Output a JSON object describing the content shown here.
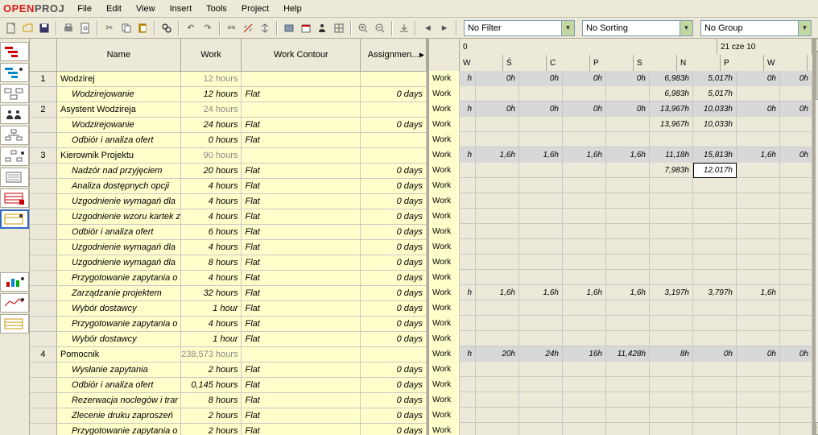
{
  "app": {
    "logo_open": "OPEN",
    "logo_proj": "PROJ"
  },
  "menu": [
    "File",
    "Edit",
    "View",
    "Insert",
    "Tools",
    "Project",
    "Help"
  ],
  "filters": {
    "filter": "No Filter",
    "sort": "No Sorting",
    "group": "No Group"
  },
  "columns": {
    "name": "Name",
    "work": "Work",
    "contour": "Work Contour",
    "assign": "Assignmen..."
  },
  "timeline": {
    "top_left": "0",
    "top_right": "21 cze 10",
    "days": [
      "W",
      "Ś",
      "C",
      "P",
      "S",
      "N",
      "P",
      "W"
    ]
  },
  "work_label": "Work",
  "rows": [
    {
      "n": "1",
      "name": "Wodzirej",
      "work": "12 hours",
      "contour": "",
      "assign": "",
      "parent": true,
      "r": [
        "h",
        "0h",
        "0h",
        "0h",
        "0h",
        "6,983h",
        "5,017h",
        "0h",
        "0h"
      ],
      "dim": true
    },
    {
      "n": "",
      "name": "Wodzirejowanie",
      "work": "12 hours",
      "contour": "Flat",
      "assign": "0 days",
      "parent": false,
      "r": [
        "",
        "",
        "",
        "",
        "",
        "6,983h",
        "5,017h",
        "",
        ""
      ],
      "dim": false
    },
    {
      "n": "2",
      "name": "Asystent Wodzireja",
      "work": "24 hours",
      "contour": "",
      "assign": "",
      "parent": true,
      "r": [
        "h",
        "0h",
        "0h",
        "0h",
        "0h",
        "13,967h",
        "10,033h",
        "0h",
        "0h"
      ],
      "dim": true
    },
    {
      "n": "",
      "name": "Wodzirejowanie",
      "work": "24 hours",
      "contour": "Flat",
      "assign": "0 days",
      "parent": false,
      "r": [
        "",
        "",
        "",
        "",
        "",
        "13,967h",
        "10,033h",
        "",
        ""
      ],
      "dim": false
    },
    {
      "n": "",
      "name": "Odbiór i analiza ofert",
      "work": "0 hours",
      "contour": "Flat",
      "assign": "",
      "parent": false,
      "r": [
        "",
        "",
        "",
        "",
        "",
        "",
        "",
        "",
        ""
      ],
      "dim": false
    },
    {
      "n": "3",
      "name": "Kierownik Projektu",
      "work": "90 hours",
      "contour": "",
      "assign": "",
      "parent": true,
      "r": [
        "h",
        "1,6h",
        "1,6h",
        "1,6h",
        "1,6h",
        "11,18h",
        "15,813h",
        "1,6h",
        "0h"
      ],
      "dim": true
    },
    {
      "n": "",
      "name": "Nadzór nad przyjęciem",
      "work": "20 hours",
      "contour": "Flat",
      "assign": "0 days",
      "parent": false,
      "r": [
        "",
        "",
        "",
        "",
        "",
        "7,983h",
        "12,017h",
        "",
        ""
      ],
      "dim": false,
      "sel": 6
    },
    {
      "n": "",
      "name": "Analiza dostępnych opcji",
      "work": "4 hours",
      "contour": "Flat",
      "assign": "0 days",
      "parent": false,
      "r": [
        "",
        "",
        "",
        "",
        "",
        "",
        "",
        "",
        ""
      ],
      "dim": false
    },
    {
      "n": "",
      "name": "Uzgodnienie wymagań dla",
      "work": "4 hours",
      "contour": "Flat",
      "assign": "0 days",
      "parent": false,
      "r": [
        "",
        "",
        "",
        "",
        "",
        "",
        "",
        "",
        ""
      ],
      "dim": false
    },
    {
      "n": "",
      "name": "Uzgodnienie wzoru kartek z",
      "work": "4 hours",
      "contour": "Flat",
      "assign": "0 days",
      "parent": false,
      "r": [
        "",
        "",
        "",
        "",
        "",
        "",
        "",
        "",
        ""
      ],
      "dim": false
    },
    {
      "n": "",
      "name": "Odbiór i analiza ofert",
      "work": "6 hours",
      "contour": "Flat",
      "assign": "0 days",
      "parent": false,
      "r": [
        "",
        "",
        "",
        "",
        "",
        "",
        "",
        "",
        ""
      ],
      "dim": false
    },
    {
      "n": "",
      "name": "Uzgodnienie wymagań dla",
      "work": "4 hours",
      "contour": "Flat",
      "assign": "0 days",
      "parent": false,
      "r": [
        "",
        "",
        "",
        "",
        "",
        "",
        "",
        "",
        ""
      ],
      "dim": false
    },
    {
      "n": "",
      "name": "Uzgodnienie wymagań dla",
      "work": "8 hours",
      "contour": "Flat",
      "assign": "0 days",
      "parent": false,
      "r": [
        "",
        "",
        "",
        "",
        "",
        "",
        "",
        "",
        ""
      ],
      "dim": false
    },
    {
      "n": "",
      "name": "Przygotowanie zapytania o",
      "work": "4 hours",
      "contour": "Flat",
      "assign": "0 days",
      "parent": false,
      "r": [
        "",
        "",
        "",
        "",
        "",
        "",
        "",
        "",
        ""
      ],
      "dim": false
    },
    {
      "n": "",
      "name": "Zarządzanie projektem",
      "work": "32 hours",
      "contour": "Flat",
      "assign": "0 days",
      "parent": false,
      "r": [
        "h",
        "1,6h",
        "1,6h",
        "1,6h",
        "1,6h",
        "3,197h",
        "3,797h",
        "1,6h",
        ""
      ],
      "dim": false
    },
    {
      "n": "",
      "name": "Wybór dostawcy",
      "work": "1 hour",
      "contour": "Flat",
      "assign": "0 days",
      "parent": false,
      "r": [
        "",
        "",
        "",
        "",
        "",
        "",
        "",
        "",
        ""
      ],
      "dim": false
    },
    {
      "n": "",
      "name": "Przygotowanie zapytania o",
      "work": "4 hours",
      "contour": "Flat",
      "assign": "0 days",
      "parent": false,
      "r": [
        "",
        "",
        "",
        "",
        "",
        "",
        "",
        "",
        ""
      ],
      "dim": false
    },
    {
      "n": "",
      "name": "Wybór dostawcy",
      "work": "1 hour",
      "contour": "Flat",
      "assign": "0 days",
      "parent": false,
      "r": [
        "",
        "",
        "",
        "",
        "",
        "",
        "",
        "",
        ""
      ],
      "dim": false
    },
    {
      "n": "4",
      "name": "Pomocnik",
      "work": "238,573 hours",
      "contour": "",
      "assign": "",
      "parent": true,
      "r": [
        "h",
        "20h",
        "24h",
        "16h",
        "11,428h",
        "8h",
        "0h",
        "0h",
        "0h"
      ],
      "dim": true
    },
    {
      "n": "",
      "name": "Wysłanie zapytania",
      "work": "2 hours",
      "contour": "Flat",
      "assign": "0 days",
      "parent": false,
      "r": [
        "",
        "",
        "",
        "",
        "",
        "",
        "",
        "",
        ""
      ],
      "dim": false
    },
    {
      "n": "",
      "name": "Odbiór i analiza ofert",
      "work": "0,145 hours",
      "contour": "Flat",
      "assign": "0 days",
      "parent": false,
      "r": [
        "",
        "",
        "",
        "",
        "",
        "",
        "",
        "",
        ""
      ],
      "dim": false
    },
    {
      "n": "",
      "name": "Rezerwacja noclegów i trar",
      "work": "8 hours",
      "contour": "Flat",
      "assign": "0 days",
      "parent": false,
      "r": [
        "",
        "",
        "",
        "",
        "",
        "",
        "",
        "",
        ""
      ],
      "dim": false
    },
    {
      "n": "",
      "name": "Zlecenie druku zaproszeń",
      "work": "2 hours",
      "contour": "Flat",
      "assign": "0 days",
      "parent": false,
      "r": [
        "",
        "",
        "",
        "",
        "",
        "",
        "",
        "",
        ""
      ],
      "dim": false
    },
    {
      "n": "",
      "name": "Przygotowanie zapytania o",
      "work": "2 hours",
      "contour": "Flat",
      "assign": "0 days",
      "parent": false,
      "r": [
        "",
        "",
        "",
        "",
        "",
        "",
        "",
        "",
        ""
      ],
      "dim": false
    }
  ]
}
